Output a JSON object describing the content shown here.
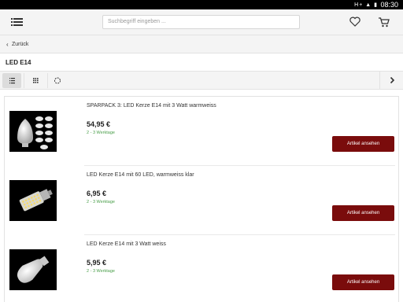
{
  "status_bar": {
    "signal": "H+",
    "time": "08:30"
  },
  "header": {
    "search_placeholder": "Suchbegriff eingeben ..."
  },
  "back": {
    "label": "Zurück"
  },
  "page_title": "LED E14",
  "products": [
    {
      "name": "SPARPACK 3: LED Kerze E14 mit 3 Watt warmweiss",
      "price": "54,95 €",
      "delivery": "2 - 3 Werktage",
      "button": "Artikel ansehen"
    },
    {
      "name": "LED Kerze E14 mit 60 LED, warmweiss klar",
      "price": "6,95 €",
      "delivery": "2 - 3 Werktage",
      "button": "Artikel ansehen"
    },
    {
      "name": "LED Kerze E14 mit 3 Watt weiss",
      "price": "5,95 €",
      "delivery": "2 - 3 Werktage",
      "button": "Artikel ansehen"
    }
  ],
  "colors": {
    "cta": "#7a0c0c",
    "delivery": "#4a9e4a"
  }
}
